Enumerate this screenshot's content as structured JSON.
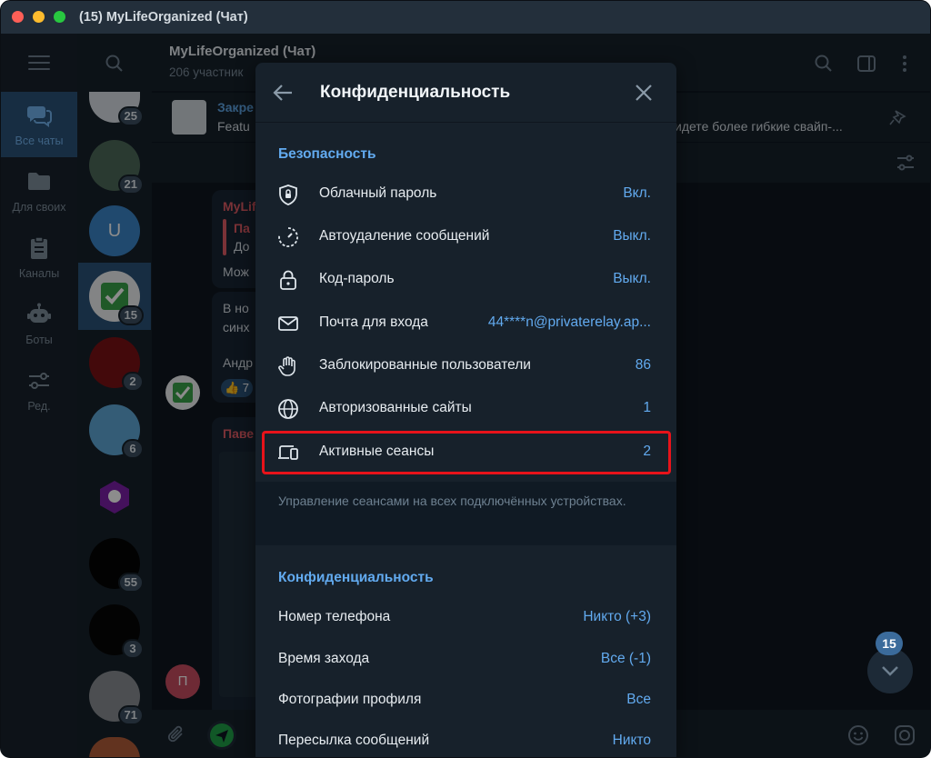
{
  "window": {
    "title": "(15) MyLifeOrganized (Чат)"
  },
  "rail": {
    "items": [
      {
        "label": "Все чаты",
        "icon": "chats-icon",
        "active": true
      },
      {
        "label": "Для своих",
        "icon": "folder-icon"
      },
      {
        "label": "Каналы",
        "icon": "clipboard-icon"
      },
      {
        "label": "Боты",
        "icon": "bot-icon"
      },
      {
        "label": "Ред.",
        "icon": "edit-sliders-icon"
      }
    ]
  },
  "chatlist": {
    "badges": [
      "25",
      "21",
      "15",
      "2",
      "6",
      "55",
      "3",
      "71"
    ],
    "letter_avatar": "U"
  },
  "chat": {
    "title": "MyLifeOrganized (Чат)",
    "subtitle": "206 участник",
    "pinned_title": "Закре",
    "pinned_text": "Featu",
    "pinned_tail": "идете более гибкие свайп-...",
    "msg1_name": "MyLif",
    "msg1_quote_a": "Па",
    "msg1_quote_b": "До",
    "msg1_text": "Мож",
    "msg2_line1": "В но",
    "msg2_line2": "синх",
    "msg2_name": "Андр",
    "msg2_reaction": "👍 7",
    "msg3_name": "Паве",
    "avatar_letter": "П"
  },
  "privacy": {
    "title": "Конфиденциальность",
    "security_header": "Безопасность",
    "security_rows": [
      {
        "icon": "shield-icon",
        "label": "Облачный пароль",
        "value": "Вкл."
      },
      {
        "icon": "timer-icon",
        "label": "Автоудаление сообщений",
        "value": "Выкл."
      },
      {
        "icon": "lock-icon",
        "label": "Код-пароль",
        "value": "Выкл."
      },
      {
        "icon": "mail-icon",
        "label": "Почта для входа",
        "value": "44****n@privaterelay.ap..."
      },
      {
        "icon": "hand-icon",
        "label": "Заблокированные пользователи",
        "value": "86"
      },
      {
        "icon": "globe-icon",
        "label": "Авторизованные сайты",
        "value": "1"
      },
      {
        "icon": "devices-icon",
        "label": "Активные сеансы",
        "value": "2"
      }
    ],
    "sessions_note": "Управление сеансами на всех подключённых устройствах.",
    "privacy_header": "Конфиденциальность",
    "privacy_rows": [
      {
        "label": "Номер телефона",
        "value": "Никто (+3)"
      },
      {
        "label": "Время захода",
        "value": "Все (-1)"
      },
      {
        "label": "Фотографии профиля",
        "value": "Все"
      },
      {
        "label": "Пересылка сообщений",
        "value": "Никто"
      }
    ]
  },
  "unread_counter": "15",
  "colors": {
    "accent": "#62aaef",
    "highlight": "#e8131a",
    "panel": "#17212b"
  }
}
